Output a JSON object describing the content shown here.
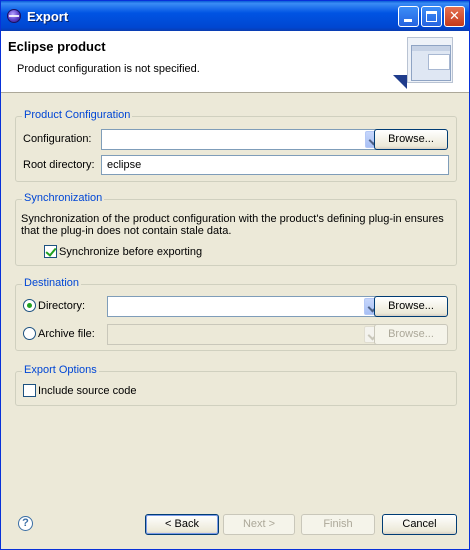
{
  "window": {
    "title": "Export",
    "icon": "eclipse-icon",
    "controls": [
      "minimize-icon",
      "maximize-icon",
      "close-icon"
    ],
    "close_glyph": "✕"
  },
  "header": {
    "title": "Eclipse product",
    "message": "Product configuration is not specified.",
    "graphic": "export-wizard-graphic"
  },
  "product_configuration": {
    "group_label": "Product Configuration",
    "configuration_label": "Configuration:",
    "configuration_value": "",
    "browse_label": "Browse...",
    "root_directory_label": "Root directory:",
    "root_directory_value": "eclipse"
  },
  "synchronization": {
    "group_label": "Synchronization",
    "description_line1": "Synchronization of the product configuration with the product's defining plug-in ensures",
    "description_line2": "that the plug-in does not contain stale data.",
    "checkbox_label": "Synchronize before exporting",
    "checked": true
  },
  "destination": {
    "group_label": "Destination",
    "directory_label": "Directory:",
    "directory_selected": true,
    "directory_value": "",
    "directory_browse_label": "Browse...",
    "archive_label": "Archive file:",
    "archive_selected": false,
    "archive_value": "",
    "archive_browse_label": "Browse..."
  },
  "export_options": {
    "group_label": "Export Options",
    "include_source_label": "Include source code",
    "include_source_checked": false
  },
  "footer": {
    "help_glyph": "?",
    "back_label": "< Back",
    "next_label": "Next >",
    "finish_label": "Finish",
    "cancel_label": "Cancel"
  },
  "colors": {
    "titlebar": "#0054e3",
    "group_label": "#0046d5",
    "dialog_background": "#ece9d8"
  }
}
